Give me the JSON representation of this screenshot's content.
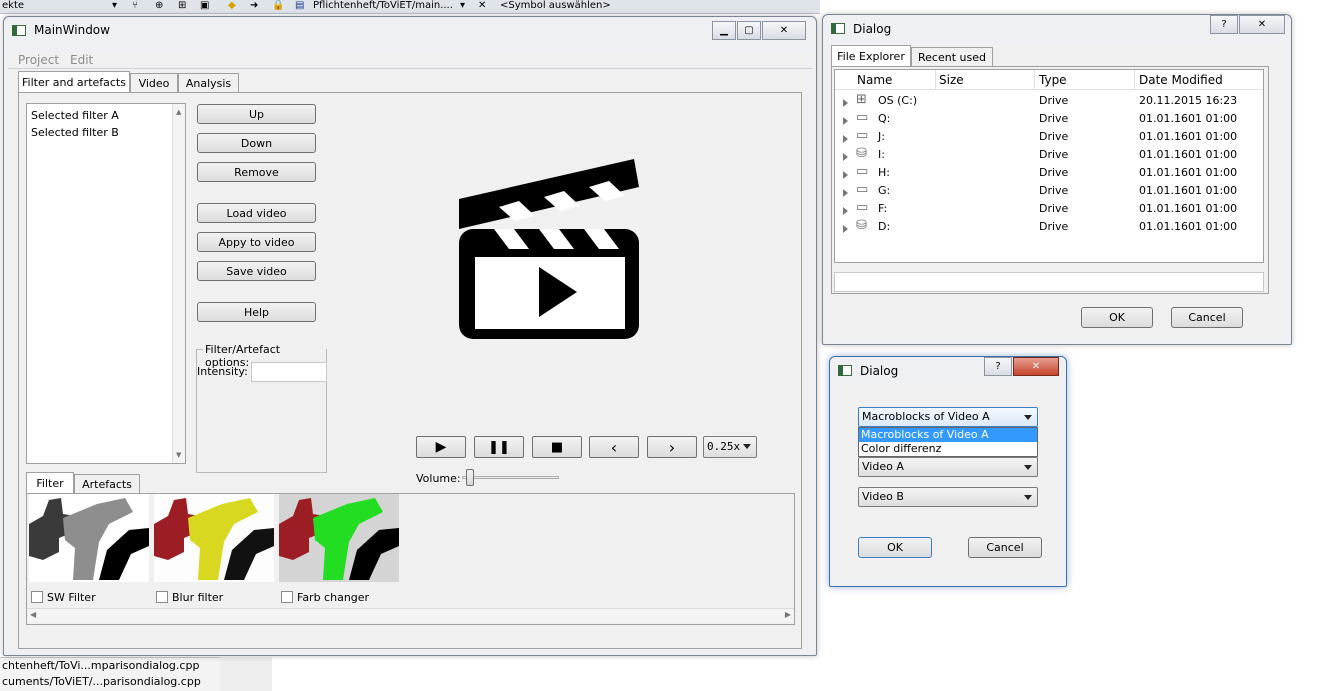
{
  "ide": {
    "top_fragment": "ekte",
    "file_tab": "Pflichtenheft/ToViET/main....",
    "symbol_select": "<Symbol auswählen>",
    "bottom_line1": "chtenheft/ToVi...mparisondialog.cpp",
    "bottom_line2": "cuments/ToViET/...parisondialog.cpp"
  },
  "main_window": {
    "title": "MainWindow",
    "menu": [
      "Project",
      "Edit"
    ],
    "tabs": [
      "Filter and artefacts",
      "Video",
      "Analysis"
    ],
    "filter_list": [
      "Selected filter A",
      "Selected filter B"
    ],
    "buttons": {
      "up": "Up",
      "down": "Down",
      "remove": "Remove",
      "load": "Load video",
      "apply": "Appy to video",
      "save": "Save video",
      "help": "Help"
    },
    "options_group": "Filter/Artefact options:",
    "intensity_label": "Intensity:",
    "speed": "0.25x",
    "volume_label": "Volume:",
    "volume_level": 0.05,
    "bottom_tabs": [
      "Filter",
      "Artefacts"
    ],
    "filters": [
      {
        "label": "SW Filter"
      },
      {
        "label": "Blur filter"
      },
      {
        "label": "Farb changer"
      }
    ]
  },
  "file_dialog": {
    "title": "Dialog",
    "tabs": [
      "File Explorer",
      "Recent used"
    ],
    "columns": [
      "Name",
      "Size",
      "Type",
      "Date Modified"
    ],
    "rows": [
      {
        "name": "OS (C:)",
        "size": "",
        "type": "Drive",
        "date": "20.11.2015 16:23",
        "icon": "windows-drive-icon"
      },
      {
        "name": "Q:",
        "size": "",
        "type": "Drive",
        "date": "01.01.1601 01:00",
        "icon": "drive-icon"
      },
      {
        "name": "J:",
        "size": "",
        "type": "Drive",
        "date": "01.01.1601 01:00",
        "icon": "drive-icon"
      },
      {
        "name": "I:",
        "size": "",
        "type": "Drive",
        "date": "01.01.1601 01:00",
        "icon": "network-drive-icon"
      },
      {
        "name": "H:",
        "size": "",
        "type": "Drive",
        "date": "01.01.1601 01:00",
        "icon": "drive-icon"
      },
      {
        "name": "G:",
        "size": "",
        "type": "Drive",
        "date": "01.01.1601 01:00",
        "icon": "drive-icon"
      },
      {
        "name": "F:",
        "size": "",
        "type": "Drive",
        "date": "01.01.1601 01:00",
        "icon": "drive-icon"
      },
      {
        "name": "D:",
        "size": "",
        "type": "Drive",
        "date": "01.01.1601 01:00",
        "icon": "network-drive-icon"
      }
    ],
    "ok": "OK",
    "cancel": "Cancel"
  },
  "compare_dialog": {
    "title": "Dialog",
    "combo_selected": "Macroblocks of Video A",
    "combo_options": [
      "Macroblocks of Video A",
      "Color differenz"
    ],
    "video_a": "Video A",
    "video_b": "Video B",
    "ok": "OK",
    "cancel": "Cancel"
  },
  "colors": {
    "selection": "#3399ff",
    "bw_gray": "#8e8e8e",
    "blur_yellow": "#d8d820",
    "color_green": "#22dd22",
    "dark_red": "#9c1e24"
  }
}
